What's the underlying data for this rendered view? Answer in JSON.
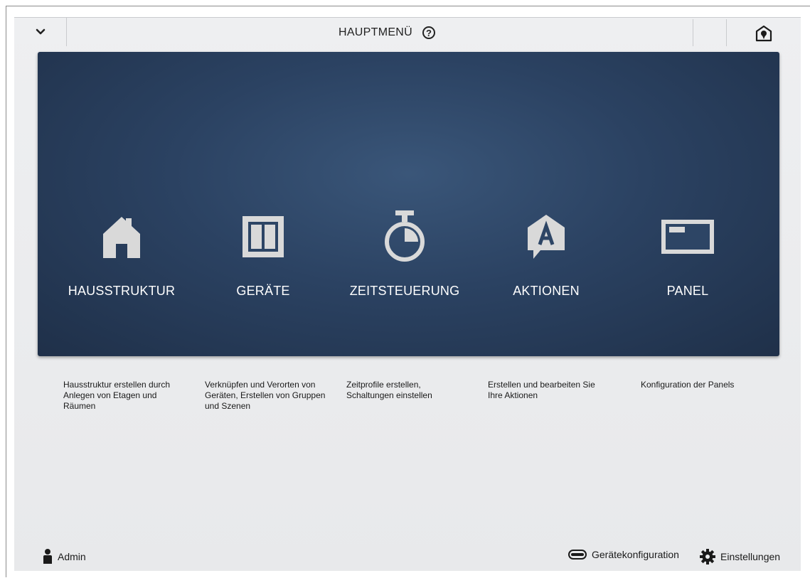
{
  "header": {
    "title": "HAUPTMENÜ",
    "help_glyph": "?",
    "collapse_icon": "chevron-down-icon",
    "right_icon": "house-alert-icon"
  },
  "tiles": [
    {
      "label": "HAUSSTRUKTUR",
      "icon": "house-icon",
      "description": "Hausstruktur erstellen durch Anlegen von Etagen und Räumen"
    },
    {
      "label": "GERÄTE",
      "icon": "switch-icon",
      "description": "Verknüpfen und Verorten von Geräten, Erstellen von Gruppen und Szenen"
    },
    {
      "label": "ZEITSTEUERUNG",
      "icon": "stopwatch-icon",
      "description": "Zeitprofile erstellen, Schaltungen einstellen"
    },
    {
      "label": "AKTIONEN",
      "icon": "action-icon",
      "description": "Erstellen und bearbeiten Sie Ihre Aktionen"
    },
    {
      "label": "PANEL",
      "icon": "panel-icon",
      "description": "Konfiguration der Panels"
    }
  ],
  "footer": {
    "user": "Admin",
    "device_config": "Gerätekonfiguration",
    "settings": "Einstellungen"
  },
  "colors": {
    "panel_dark": "#1f3049",
    "panel_light": "#3a5679",
    "icon_gray": "#d9d9d9",
    "background": "#eceef0"
  }
}
